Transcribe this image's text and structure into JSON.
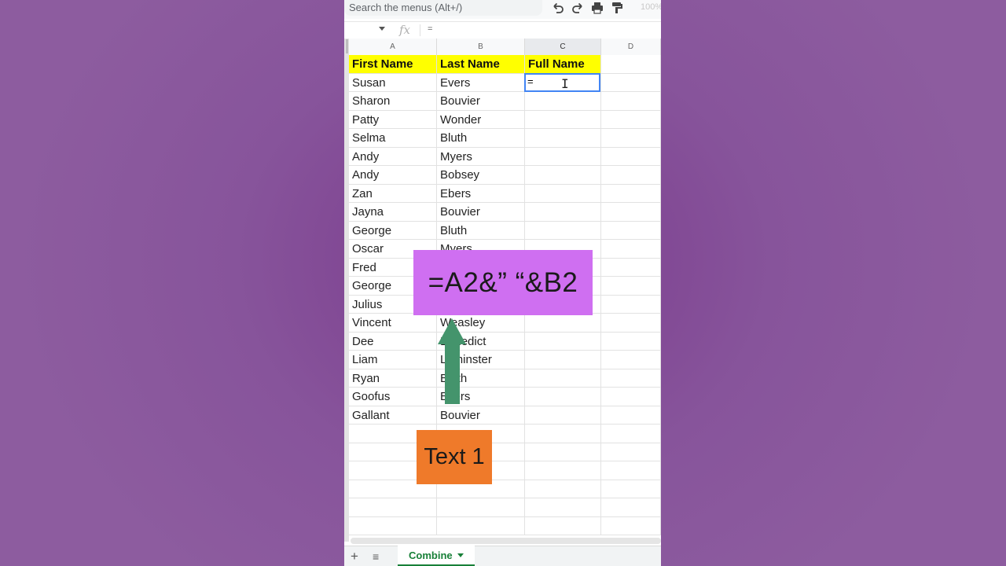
{
  "toolbar": {
    "menu_search_placeholder": "Search the menus (Alt+/)",
    "zoom_level": "100%",
    "icons": [
      "undo-icon",
      "redo-icon",
      "print-icon",
      "paint-format-icon"
    ]
  },
  "formula_bar": {
    "fx_label": "fx",
    "content": "="
  },
  "columns": [
    "A",
    "B",
    "C",
    "D"
  ],
  "active_column": "C",
  "sheet": {
    "header": {
      "a": "First Name",
      "b": "Last Name",
      "c": "Full Name"
    },
    "rows": [
      {
        "a": "Susan",
        "b": "Evers"
      },
      {
        "a": "Sharon",
        "b": "Bouvier"
      },
      {
        "a": "Patty",
        "b": "Wonder"
      },
      {
        "a": "Selma",
        "b": "Bluth"
      },
      {
        "a": "Andy",
        "b": "Myers"
      },
      {
        "a": "Andy",
        "b": "Bobsey"
      },
      {
        "a": "Zan",
        "b": "Ebers"
      },
      {
        "a": "Jayna",
        "b": "Bouvier"
      },
      {
        "a": "George",
        "b": "Bluth"
      },
      {
        "a": "Oscar",
        "b": "Myers"
      },
      {
        "a": "Fred",
        "b": ""
      },
      {
        "a": "George",
        "b": ""
      },
      {
        "a": "Julius",
        "b": ""
      },
      {
        "a": "Vincent",
        "b": "Weasley"
      },
      {
        "a": "Dee",
        "b": "Benedict"
      },
      {
        "a": "Liam",
        "b": "Leminster"
      },
      {
        "a": "Ryan",
        "b": "Bluth"
      },
      {
        "a": "Goofus",
        "b": "Evers"
      },
      {
        "a": "Gallant",
        "b": "Bouvier"
      }
    ],
    "empty_rows": 6,
    "selected_cell_input": "="
  },
  "overlay": {
    "formula": "=A2&” “&B2",
    "label": "Text 1",
    "formula_bg": "#cf6ff1",
    "label_bg": "#ef7a2a",
    "arrow_color": "#44946c"
  },
  "sheet_tabs": {
    "active": "Combine"
  },
  "colors": {
    "header_fill": "#ffff00",
    "selection": "#4285f4",
    "tab_accent": "#188038"
  }
}
